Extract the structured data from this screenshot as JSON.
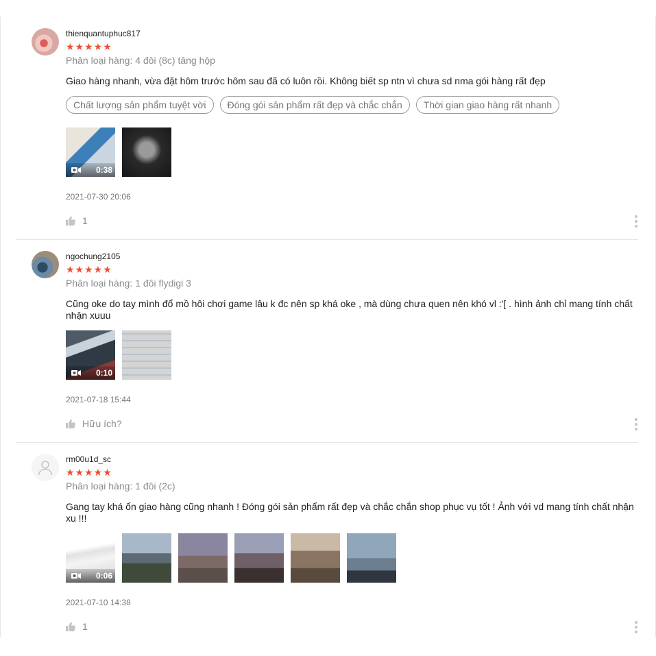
{
  "reviews": [
    {
      "username": "thienquantuphuc817",
      "stars": "★★★★★",
      "variation": "Phân loại hàng: 4 đôi (8c) tăng hộp",
      "comment": "Giao hàng nhanh, vừa đặt hôm trước hôm sau đã có luôn rồi. Không biết sp ntn vì chưa sd nma gói hàng rất đẹp",
      "tags": [
        "Chất lượng sản phẩm tuyệt vời",
        "Đóng gói sản phẩm rất đẹp và chắc chắn",
        "Thời gian giao hàng rất nhanh"
      ],
      "video_duration": "0:38",
      "date": "2021-07-30 20:06",
      "likes": "1"
    },
    {
      "username": "ngochung2105",
      "stars": "★★★★★",
      "variation": "Phân loại hàng: 1 đôi flydigi 3",
      "comment": "Cũng oke do tay mình đổ mồ hôi chơi game lâu k đc nên sp khá oke , mà dùng chưa quen nên khó vl :'[ . hình ảnh chỉ mang tính chất nhận xuuu",
      "video_duration": "0:10",
      "date": "2021-07-18 15:44",
      "likes": "Hữu ích?"
    },
    {
      "username": "rm00u1d_sc",
      "stars": "★★★★★",
      "variation": "Phân loại hàng: 1 đôi (2c)",
      "comment": "Gang tay khá ổn giao hàng cũng nhanh ! Đóng gói sản phẩm rất đẹp và chắc chắn  shop phục vụ tốt ! Ảnh với vd mang tính chất nhận xu !!!",
      "video_duration": "0:06",
      "date": "2021-07-10 14:38",
      "likes": "1"
    }
  ],
  "colors": {
    "star": "#ee4d2d",
    "muted": "#8a8a8a",
    "divider": "#e6e6e6"
  },
  "icons": {
    "like": "thumbs-up-icon",
    "more": "more-vertical-icon",
    "video": "video-camera-icon",
    "default_avatar": "user-icon"
  }
}
